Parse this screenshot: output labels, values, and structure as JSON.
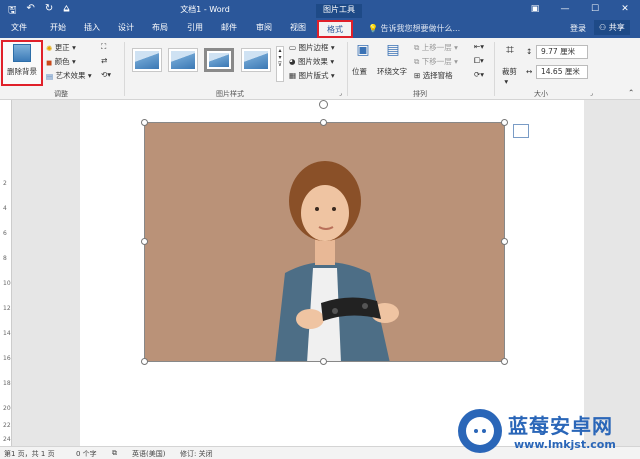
{
  "titlebar": {
    "doc_title": "文档1 - Word",
    "context_title": "图片工具",
    "quick_access": [
      "save-icon",
      "undo-icon",
      "redo-icon",
      "customize-icon"
    ],
    "window_controls": [
      "ribbon-display-icon",
      "minimize-icon",
      "maximize-icon",
      "close-icon"
    ]
  },
  "tabs": {
    "file": "文件",
    "home": "开始",
    "insert": "插入",
    "design": "设计",
    "layout": "布局",
    "references": "引用",
    "mailings": "邮件",
    "review": "审阅",
    "view": "视图",
    "format": "格式",
    "tell_me": "告诉我您想要做什么...",
    "login": "登录",
    "share": "共享"
  },
  "ribbon": {
    "adjust": {
      "remove_bg": "删除背景",
      "corrections": "更正",
      "color": "颜色",
      "artistic": "艺术效果",
      "label": "调整"
    },
    "styles": {
      "label": "图片样式",
      "border": "图片边框",
      "effects": "图片效果",
      "layout": "图片版式"
    },
    "arrange": {
      "label": "排列",
      "position": "位置",
      "wrap": "环绕文字",
      "forward": "上移一层",
      "backward": "下移一层",
      "selection_pane": "选择窗格"
    },
    "size": {
      "label": "大小",
      "crop": "裁剪",
      "height": "9.77 厘米",
      "width": "14.65 厘米"
    }
  },
  "ruler_numbers": [
    "2",
    "4",
    "6",
    "8",
    "10",
    "12",
    "14",
    "16",
    "18",
    "20",
    "22",
    "24"
  ],
  "statusbar": {
    "page": "第1 页，共 1 页",
    "words": "0 个字",
    "language": "英语(美国)",
    "track": "修订: 关闭"
  },
  "watermark": {
    "name": "蓝莓安卓网",
    "url": "www.lmkjst.com"
  },
  "colors": {
    "word_blue": "#2b579a",
    "highlight_red": "#e0202a",
    "photo_background": "#b68e73"
  }
}
